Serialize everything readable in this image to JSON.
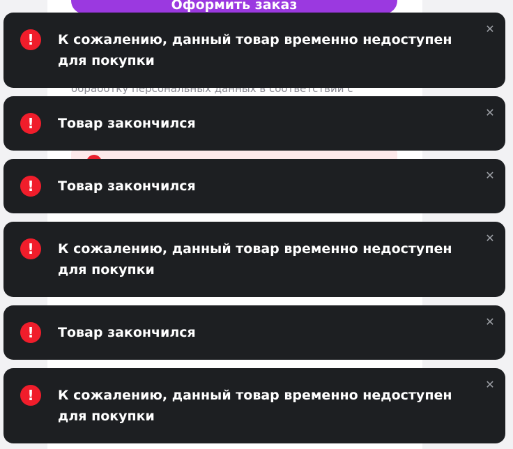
{
  "page": {
    "checkout_button_label": "Оформить заказ",
    "consent_text_fragment": "обработку персональных данных в соответствии с"
  },
  "toasts": [
    {
      "message": "К сожалению, данный товар временно недоступен для покупки",
      "icon": "exclamation-icon",
      "close_icon": "close-icon"
    },
    {
      "message": "Товар закончился",
      "icon": "exclamation-icon",
      "close_icon": "close-icon"
    },
    {
      "message": "Товар закончился",
      "icon": "exclamation-icon",
      "close_icon": "close-icon"
    },
    {
      "message": "К сожалению, данный товар временно недоступен для покупки",
      "icon": "exclamation-icon",
      "close_icon": "close-icon"
    },
    {
      "message": "Товар закончился",
      "icon": "exclamation-icon",
      "close_icon": "close-icon"
    },
    {
      "message": "К сожалению, данный товар временно недоступен для покупки",
      "icon": "exclamation-icon",
      "close_icon": "close-icon"
    }
  ],
  "colors": {
    "toast_background": "#1d1f22",
    "error_icon": "#f01d2b",
    "checkout_button": "#9b39e0"
  }
}
